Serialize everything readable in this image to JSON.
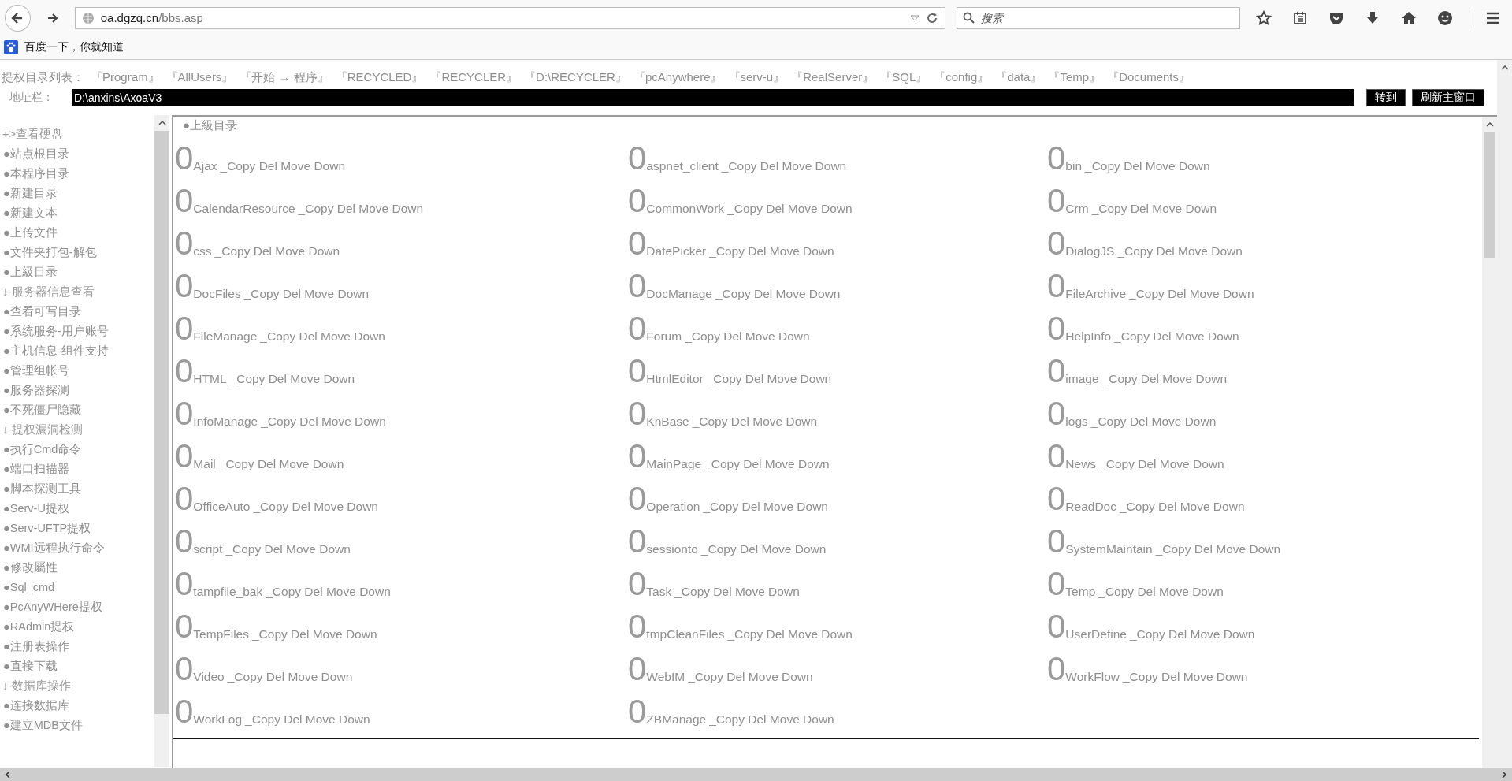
{
  "browser": {
    "url_host": "oa.dgzq.cn",
    "url_path": "/bbs.asp",
    "search_placeholder": "搜索",
    "bookmark": "百度一下，你就知道"
  },
  "path_links": {
    "label": "提权目录列表：",
    "items": [
      "『Program』",
      "『AllUsers』",
      "『开始 → 程序』",
      "『RECYCLED』",
      "『RECYCLER』",
      "『D:\\RECYCLER』",
      "『pcAnywhere』",
      "『serv-u』",
      "『RealServer』",
      "『SQL』",
      "『config』",
      "『data』",
      "『Temp』",
      "『Documents』"
    ]
  },
  "address": {
    "label": "地址栏：",
    "value": "D:\\anxins\\AxoaV3",
    "buttons": [
      "转到",
      "刷新主窗口"
    ]
  },
  "sidebar": {
    "items": [
      {
        "kind": "header",
        "text": "+>查看硬盘"
      },
      {
        "kind": "link",
        "text": "●站点根目录"
      },
      {
        "kind": "link",
        "text": "●本程序目录"
      },
      {
        "kind": "link",
        "text": "●新建目录"
      },
      {
        "kind": "link",
        "text": "●新建文本"
      },
      {
        "kind": "link",
        "text": "●上传文件"
      },
      {
        "kind": "link",
        "text": "●文件夹打包-解包"
      },
      {
        "kind": "link",
        "text": "●上級目录"
      },
      {
        "kind": "header",
        "text": "↓-服务器信息查看"
      },
      {
        "kind": "link",
        "text": "●查看可写目录"
      },
      {
        "kind": "link",
        "text": "●系统服务-用户账号"
      },
      {
        "kind": "link",
        "text": "●主机信息-组件支持"
      },
      {
        "kind": "link",
        "text": "●管理组帐号"
      },
      {
        "kind": "link",
        "text": "●服务器探测"
      },
      {
        "kind": "link",
        "text": "●不死僵尸隐藏"
      },
      {
        "kind": "header",
        "text": "↓-提权漏洞检测"
      },
      {
        "kind": "link",
        "text": "●执行Cmd命令"
      },
      {
        "kind": "link",
        "text": "●端口扫描器"
      },
      {
        "kind": "link",
        "text": "●脚本探测工具"
      },
      {
        "kind": "link",
        "text": "●Serv-U提权"
      },
      {
        "kind": "link",
        "text": "●Serv-UFTP提权"
      },
      {
        "kind": "link",
        "text": "●WMI远程执行命令"
      },
      {
        "kind": "link",
        "text": "●修改屬性"
      },
      {
        "kind": "link",
        "text": "●Sql_cmd"
      },
      {
        "kind": "link",
        "text": "●PcAnyWHere提权"
      },
      {
        "kind": "link",
        "text": "●RAdmin提权"
      },
      {
        "kind": "link",
        "text": "●注册表操作"
      },
      {
        "kind": "link",
        "text": "●直接下载"
      },
      {
        "kind": "header",
        "text": "↓-数据库操作"
      },
      {
        "kind": "link",
        "text": "●连接数据库"
      },
      {
        "kind": "link",
        "text": "●建立MDB文件"
      }
    ]
  },
  "main": {
    "parent_link": "●上級目录",
    "folders": [
      {
        "icon": "0",
        "name": "Ajax",
        "actions": "_Copy Del Move Down"
      },
      {
        "icon": "0",
        "name": "aspnet_client",
        "actions": "_Copy Del Move Down"
      },
      {
        "icon": "0",
        "name": "bin",
        "actions": "_Copy Del Move Down"
      },
      {
        "icon": "0",
        "name": "CalendarResource",
        "actions": "_Copy Del Move Down"
      },
      {
        "icon": "0",
        "name": "CommonWork",
        "actions": "_Copy Del Move Down"
      },
      {
        "icon": "0",
        "name": "Crm",
        "actions": "_Copy Del Move Down"
      },
      {
        "icon": "0",
        "name": "css",
        "actions": "_Copy Del Move Down"
      },
      {
        "icon": "0",
        "name": "DatePicker",
        "actions": "_Copy Del Move Down"
      },
      {
        "icon": "0",
        "name": "DialogJS",
        "actions": "_Copy Del Move Down"
      },
      {
        "icon": "0",
        "name": "DocFiles",
        "actions": "_Copy Del Move Down"
      },
      {
        "icon": "0",
        "name": "DocManage",
        "actions": "_Copy Del Move Down"
      },
      {
        "icon": "0",
        "name": "FileArchive",
        "actions": "_Copy Del Move Down"
      },
      {
        "icon": "0",
        "name": "FileManage",
        "actions": "_Copy Del Move Down"
      },
      {
        "icon": "0",
        "name": "Forum",
        "actions": "_Copy Del Move Down"
      },
      {
        "icon": "0",
        "name": "HelpInfo",
        "actions": "_Copy Del Move Down"
      },
      {
        "icon": "0",
        "name": "HTML",
        "actions": "_Copy Del Move Down"
      },
      {
        "icon": "0",
        "name": "HtmlEditor",
        "actions": "_Copy Del Move Down"
      },
      {
        "icon": "0",
        "name": "image",
        "actions": "_Copy Del Move Down"
      },
      {
        "icon": "0",
        "name": "InfoManage",
        "actions": "_Copy Del Move Down"
      },
      {
        "icon": "0",
        "name": "KnBase",
        "actions": "_Copy Del Move Down"
      },
      {
        "icon": "0",
        "name": "logs",
        "actions": "_Copy Del Move Down"
      },
      {
        "icon": "0",
        "name": "Mail",
        "actions": "_Copy Del Move Down"
      },
      {
        "icon": "0",
        "name": "MainPage",
        "actions": "_Copy Del Move Down"
      },
      {
        "icon": "0",
        "name": "News",
        "actions": "_Copy Del Move Down"
      },
      {
        "icon": "0",
        "name": "OfficeAuto",
        "actions": "_Copy Del Move Down"
      },
      {
        "icon": "0",
        "name": "Operation",
        "actions": "_Copy Del Move Down"
      },
      {
        "icon": "0",
        "name": "ReadDoc",
        "actions": "_Copy Del Move Down"
      },
      {
        "icon": "0",
        "name": "script",
        "actions": "_Copy Del Move Down"
      },
      {
        "icon": "0",
        "name": "sessionto",
        "actions": "_Copy Del Move Down"
      },
      {
        "icon": "0",
        "name": "SystemMaintain",
        "actions": "_Copy Del Move Down"
      },
      {
        "icon": "0",
        "name": "tampfile_bak",
        "actions": "_Copy Del Move Down"
      },
      {
        "icon": "0",
        "name": "Task",
        "actions": "_Copy Del Move Down"
      },
      {
        "icon": "0",
        "name": "Temp",
        "actions": "_Copy Del Move Down"
      },
      {
        "icon": "0",
        "name": "TempFiles",
        "actions": "_Copy Del Move Down"
      },
      {
        "icon": "0",
        "name": "tmpCleanFiles",
        "actions": "_Copy Del Move Down"
      },
      {
        "icon": "0",
        "name": "UserDefine",
        "actions": "_Copy Del Move Down"
      },
      {
        "icon": "0",
        "name": "Video",
        "actions": "_Copy Del Move Down"
      },
      {
        "icon": "0",
        "name": "WebIM",
        "actions": "_Copy Del Move Down"
      },
      {
        "icon": "0",
        "name": "WorkFlow",
        "actions": "_Copy Del Move Down"
      },
      {
        "icon": "0",
        "name": "WorkLog",
        "actions": "_Copy Del Move Down"
      },
      {
        "icon": "0",
        "name": "ZBManage",
        "actions": "_Copy Del Move Down"
      }
    ]
  }
}
